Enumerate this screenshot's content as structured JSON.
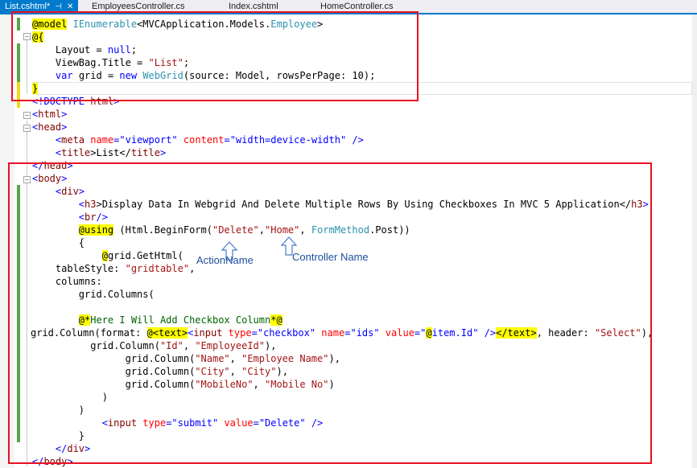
{
  "tabs": [
    {
      "label": "List.cshtml*",
      "active": true
    },
    {
      "label": "EmployeesController.cs",
      "active": false
    },
    {
      "label": "Index.cshtml",
      "active": false
    },
    {
      "label": "HomeController.cs",
      "active": false
    }
  ],
  "code": {
    "l1": {
      "a": "@model",
      "b": "IEnumerable",
      "c": "<MVCApplication.Models.",
      "d": "Employee",
      "e": ">"
    },
    "l2": {
      "a": "@{"
    },
    "l3": {
      "a": "    Layout = ",
      "b": "null",
      "c": ";"
    },
    "l4": {
      "a": "    ViewBag.Title = ",
      "b": "\"List\"",
      "c": ";"
    },
    "l5": {
      "a": "    ",
      "b": "var",
      "c": " grid = ",
      "d": "new",
      "e": " ",
      "f": "WebGrid",
      "g": "(source: Model, rowsPerPage: 10);"
    },
    "l6": {
      "a": "}"
    },
    "l7": {
      "a": "<!DOCTYPE ",
      "b": "html",
      "c": ">"
    },
    "l8": {
      "a": "<",
      "b": "html",
      "c": ">"
    },
    "l9": {
      "a": "<",
      "b": "head",
      "c": ">"
    },
    "l10": {
      "a": "    <",
      "b": "meta",
      "c": " ",
      "d": "name",
      "e": "=",
      "f": "\"viewport\"",
      "g": " ",
      "h": "content",
      "i": "=",
      "j": "\"width=device-width\"",
      "k": " />"
    },
    "l11": {
      "a": "    <",
      "b": "title",
      "c": ">List</",
      "d": "title",
      "e": ">"
    },
    "l12": {
      "a": "</",
      "b": "head",
      "c": ">"
    },
    "l13": {
      "a": "<",
      "b": "body",
      "c": ">"
    },
    "l14": {
      "a": "    <",
      "b": "div",
      "c": ">"
    },
    "l15": {
      "a": "        <",
      "b": "h3",
      "c": ">Display Data In Webgrid And Delete Multiple Rows By Using Checkboxes In MVC 5 Application</",
      "d": "h3",
      "e": ">"
    },
    "l16": {
      "a": "        <",
      "b": "br",
      "c": "/>"
    },
    "l17": {
      "a": "        ",
      "b": "@using",
      "c": " (Html.BeginForm(",
      "d": "\"Delete\"",
      "e": ",",
      "f": "\"Home\"",
      "g": ", ",
      "h": "FormMethod",
      "i": ".Post))"
    },
    "l18": {
      "a": "        {"
    },
    "l19": {
      "a": "            ",
      "b": "@",
      "c": "grid.GetHtml("
    },
    "l20": {
      "a": "    tableStyle: ",
      "b": "\"gridtable\"",
      "c": ","
    },
    "l21": {
      "a": "    columns:"
    },
    "l22": {
      "a": "        grid.Columns("
    },
    "l23": {
      "a": ""
    },
    "l24": {
      "a": "        ",
      "b": "@*",
      "c": "Here I Will Add Checkbox Column",
      "d": "*@"
    },
    "l25": {
      "a": "grid.Column(format: ",
      "b": "@<text>",
      "c": "<",
      "d": "input",
      "e": " ",
      "f": "type",
      "g": "=",
      "h": "\"checkbox\"",
      "i": " ",
      "j": "name",
      "k": "=",
      "l": "\"ids\"",
      "m": " ",
      "n": "value",
      "o": "=",
      "p": "\"",
      "q": "@",
      "r": "item.Id\"",
      "s": " />",
      "t": "</text>",
      "u": ", header: ",
      "v": "\"Select\"",
      "w": "),"
    },
    "l26": {
      "a": "          grid.Column(",
      "b": "\"Id\"",
      "c": ", ",
      "d": "\"EmployeeId\"",
      "e": "),"
    },
    "l27": {
      "a": "                grid.Column(",
      "b": "\"Name\"",
      "c": ", ",
      "d": "\"Employee Name\"",
      "e": "),"
    },
    "l28": {
      "a": "                grid.Column(",
      "b": "\"City\"",
      "c": ", ",
      "d": "\"City\"",
      "e": "),"
    },
    "l29": {
      "a": "                grid.Column(",
      "b": "\"MobileNo\"",
      "c": ", ",
      "d": "\"Mobile No\"",
      "e": ")"
    },
    "l30": {
      "a": "            )"
    },
    "l31": {
      "a": "        )"
    },
    "l32": {
      "a": "            <",
      "b": "input",
      "c": " ",
      "d": "type",
      "e": "=",
      "f": "\"submit\"",
      "g": " ",
      "h": "value",
      "i": "=",
      "j": "\"Delete\"",
      "k": " />"
    },
    "l33": {
      "a": "        }"
    },
    "l34": {
      "a": "    </",
      "b": "div",
      "c": ">"
    },
    "l35": {
      "a": "</",
      "b": "body",
      "c": ">"
    }
  },
  "annotations": {
    "action_name": "ActionName",
    "controller_name": "Controller Name"
  },
  "colors": {
    "highlight_box": "#e81123",
    "annotation_text": "#1f4e9c",
    "active_tab": "#007acc"
  }
}
